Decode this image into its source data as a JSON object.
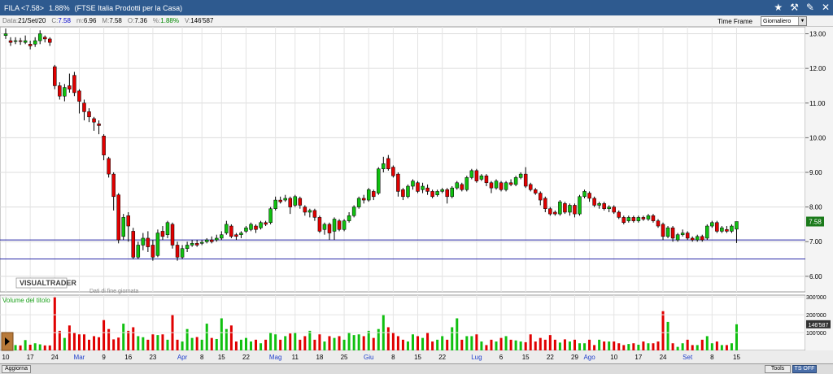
{
  "titlebar": {
    "symbol": "FILA <7.58>",
    "change": "1.88%",
    "market": "(FTSE Italia Prodotti per la Casa)",
    "icons": [
      "star-icon",
      "tool-icon",
      "pin-icon",
      "close-icon"
    ]
  },
  "infobar": {
    "date_label": "Data:",
    "date_value": "21/Set/20",
    "close_label": "C:",
    "close_value": "7.58",
    "min_label": "m:",
    "min_value": "6.96",
    "max_label": "M:",
    "max_value": "7.58",
    "open_label": "O:",
    "open_value": "7.36",
    "pct_label": "%:",
    "pct_value": "1.88%",
    "vol_label": "V:",
    "vol_value": "146'587",
    "timeframe_label": "Time Frame",
    "timeframe_value": "Giornaliero"
  },
  "footer": {
    "refresh_label": "Aggiorna",
    "tools_label": "Tools",
    "tsoff_label": "TS OFF"
  },
  "chart_data": {
    "type": "candlestick",
    "title": "",
    "price_axis_ticks": [
      "13.00",
      "12.00",
      "11.00",
      "10.00",
      "9.00",
      "8.00",
      "7.00",
      "6.00"
    ],
    "price_range": [
      5.55,
      13.2
    ],
    "last_price_label": "7.58",
    "watermark": "VISUALTRADER",
    "watermark_sub": "Dati di fine giornata",
    "volume_title": "Volume del titolo",
    "volume_ticks": [
      "300'000",
      "200'000",
      "100'000"
    ],
    "volume_range": [
      0,
      310000
    ],
    "last_volume_label": "146'587",
    "horizontal_lines": [
      7.05,
      6.5
    ],
    "date_labels": [
      {
        "i": 0,
        "text": "10",
        "month": false
      },
      {
        "i": 5,
        "text": "17",
        "month": false
      },
      {
        "i": 10,
        "text": "24",
        "month": false
      },
      {
        "i": 15,
        "text": "Mar",
        "month": true
      },
      {
        "i": 20,
        "text": "9",
        "month": false
      },
      {
        "i": 25,
        "text": "16",
        "month": false
      },
      {
        "i": 30,
        "text": "23",
        "month": false
      },
      {
        "i": 36,
        "text": "Apr",
        "month": true
      },
      {
        "i": 40,
        "text": "8",
        "month": false
      },
      {
        "i": 44,
        "text": "15",
        "month": false
      },
      {
        "i": 49,
        "text": "22",
        "month": false
      },
      {
        "i": 55,
        "text": "Mag",
        "month": true
      },
      {
        "i": 59,
        "text": "11",
        "month": false
      },
      {
        "i": 64,
        "text": "18",
        "month": false
      },
      {
        "i": 69,
        "text": "25",
        "month": false
      },
      {
        "i": 74,
        "text": "Giu",
        "month": true
      },
      {
        "i": 79,
        "text": "8",
        "month": false
      },
      {
        "i": 84,
        "text": "15",
        "month": false
      },
      {
        "i": 89,
        "text": "22",
        "month": false
      },
      {
        "i": 96,
        "text": "Lug",
        "month": true
      },
      {
        "i": 101,
        "text": "6",
        "month": false
      },
      {
        "i": 106,
        "text": "15",
        "month": false
      },
      {
        "i": 111,
        "text": "22",
        "month": false
      },
      {
        "i": 116,
        "text": "29",
        "month": false
      },
      {
        "i": 119,
        "text": "Ago",
        "month": true
      },
      {
        "i": 124,
        "text": "10",
        "month": false
      },
      {
        "i": 129,
        "text": "17",
        "month": false
      },
      {
        "i": 134,
        "text": "24",
        "month": false
      },
      {
        "i": 139,
        "text": "Set",
        "month": true
      },
      {
        "i": 144,
        "text": "8",
        "month": false
      },
      {
        "i": 149,
        "text": "15",
        "month": false
      }
    ],
    "candles": [
      [
        12.95,
        13.0,
        12.85,
        13.15
      ],
      [
        12.8,
        12.75,
        12.65,
        12.9
      ],
      [
        12.78,
        12.8,
        12.7,
        12.9
      ],
      [
        12.8,
        12.78,
        12.68,
        12.88
      ],
      [
        12.75,
        12.8,
        12.7,
        12.95
      ],
      [
        12.7,
        12.65,
        12.55,
        12.8
      ],
      [
        12.7,
        12.8,
        12.62,
        12.9
      ],
      [
        12.8,
        13.0,
        12.7,
        13.1
      ],
      [
        12.9,
        12.85,
        12.75,
        12.95
      ],
      [
        12.85,
        12.75,
        12.65,
        12.9
      ],
      [
        12.05,
        11.5,
        11.4,
        12.1
      ],
      [
        11.5,
        11.2,
        11.1,
        11.6
      ],
      [
        11.2,
        11.45,
        11.05,
        11.55
      ],
      [
        11.5,
        11.4,
        11.3,
        11.85
      ],
      [
        11.8,
        11.3,
        11.2,
        11.9
      ],
      [
        11.35,
        11.05,
        10.7,
        11.4
      ],
      [
        11.0,
        10.75,
        10.5,
        11.1
      ],
      [
        10.75,
        10.6,
        10.45,
        10.85
      ],
      [
        10.55,
        10.45,
        10.2,
        10.6
      ],
      [
        10.4,
        10.35,
        10.1,
        10.5
      ],
      [
        10.05,
        9.5,
        9.35,
        10.1
      ],
      [
        9.4,
        8.95,
        8.85,
        9.45
      ],
      [
        8.95,
        8.3,
        7.9,
        9.0
      ],
      [
        8.35,
        7.05,
        6.95,
        8.4
      ],
      [
        7.15,
        7.7,
        7.05,
        7.8
      ],
      [
        7.75,
        7.45,
        7.0,
        7.85
      ],
      [
        7.3,
        6.55,
        6.5,
        7.4
      ],
      [
        6.55,
        6.9,
        6.5,
        7.0
      ],
      [
        6.9,
        7.1,
        6.75,
        7.25
      ],
      [
        7.1,
        6.85,
        6.7,
        7.3
      ],
      [
        6.9,
        6.55,
        6.45,
        7.05
      ],
      [
        6.6,
        7.25,
        6.55,
        7.35
      ],
      [
        7.3,
        7.15,
        7.05,
        7.45
      ],
      [
        7.2,
        7.55,
        7.1,
        7.6
      ],
      [
        7.5,
        6.9,
        6.8,
        7.55
      ],
      [
        6.9,
        6.55,
        6.45,
        7.0
      ],
      [
        6.55,
        6.8,
        6.5,
        6.9
      ],
      [
        6.8,
        6.9,
        6.7,
        7.0
      ],
      [
        6.9,
        6.95,
        6.85,
        7.05
      ],
      [
        6.95,
        6.9,
        6.85,
        7.05
      ],
      [
        6.95,
        6.98,
        6.9,
        7.05
      ],
      [
        7.0,
        7.05,
        6.95,
        7.1
      ],
      [
        7.05,
        7.0,
        6.95,
        7.15
      ],
      [
        7.05,
        7.1,
        7.0,
        7.2
      ],
      [
        7.1,
        7.2,
        7.05,
        7.3
      ],
      [
        7.25,
        7.5,
        7.2,
        7.6
      ],
      [
        7.45,
        7.15,
        7.1,
        7.5
      ],
      [
        7.2,
        7.15,
        7.05,
        7.25
      ],
      [
        7.2,
        7.25,
        7.1,
        7.3
      ],
      [
        7.3,
        7.4,
        7.25,
        7.45
      ],
      [
        7.35,
        7.5,
        7.3,
        7.55
      ],
      [
        7.45,
        7.35,
        7.25,
        7.5
      ],
      [
        7.4,
        7.55,
        7.35,
        7.6
      ],
      [
        7.55,
        7.5,
        7.45,
        7.6
      ],
      [
        7.55,
        7.95,
        7.5,
        8.0
      ],
      [
        7.95,
        8.2,
        7.9,
        8.3
      ],
      [
        8.2,
        8.15,
        8.1,
        8.3
      ],
      [
        8.2,
        8.25,
        8.15,
        8.35
      ],
      [
        8.25,
        8.0,
        7.8,
        8.3
      ],
      [
        8.05,
        8.3,
        8.0,
        8.35
      ],
      [
        8.25,
        8.05,
        7.95,
        8.3
      ],
      [
        8.0,
        7.85,
        7.75,
        8.05
      ],
      [
        7.85,
        7.9,
        7.7,
        7.95
      ],
      [
        7.9,
        7.7,
        7.6,
        7.95
      ],
      [
        7.7,
        7.3,
        7.25,
        7.75
      ],
      [
        7.35,
        7.5,
        7.2,
        7.55
      ],
      [
        7.5,
        7.25,
        7.05,
        7.55
      ],
      [
        7.3,
        7.65,
        7.05,
        7.7
      ],
      [
        7.6,
        7.35,
        7.3,
        7.65
      ],
      [
        7.35,
        7.6,
        7.3,
        7.65
      ],
      [
        7.6,
        7.75,
        7.55,
        7.85
      ],
      [
        7.75,
        8.0,
        7.7,
        8.05
      ],
      [
        8.0,
        8.25,
        7.95,
        8.3
      ],
      [
        8.25,
        8.2,
        8.1,
        8.35
      ],
      [
        8.2,
        8.5,
        8.15,
        8.55
      ],
      [
        8.45,
        8.3,
        8.2,
        8.5
      ],
      [
        8.4,
        9.1,
        8.35,
        9.15
      ],
      [
        9.1,
        9.25,
        9.0,
        9.45
      ],
      [
        9.4,
        9.1,
        9.05,
        9.5
      ],
      [
        9.15,
        8.9,
        8.85,
        9.2
      ],
      [
        8.95,
        8.45,
        8.3,
        9.0
      ],
      [
        8.5,
        8.3,
        8.2,
        8.55
      ],
      [
        8.3,
        8.6,
        8.25,
        8.65
      ],
      [
        8.6,
        8.75,
        8.5,
        8.8
      ],
      [
        8.7,
        8.45,
        8.4,
        8.75
      ],
      [
        8.5,
        8.6,
        8.4,
        8.7
      ],
      [
        8.55,
        8.45,
        8.35,
        8.65
      ],
      [
        8.45,
        8.3,
        8.25,
        8.5
      ],
      [
        8.35,
        8.45,
        8.3,
        8.5
      ],
      [
        8.45,
        8.5,
        8.4,
        8.55
      ],
      [
        8.5,
        8.3,
        8.1,
        8.55
      ],
      [
        8.3,
        8.55,
        8.25,
        8.6
      ],
      [
        8.55,
        8.7,
        8.5,
        8.75
      ],
      [
        8.65,
        8.5,
        8.45,
        8.7
      ],
      [
        8.5,
        8.85,
        8.45,
        8.9
      ],
      [
        8.85,
        9.05,
        8.8,
        9.1
      ],
      [
        9.05,
        8.75,
        8.7,
        9.1
      ],
      [
        8.8,
        8.9,
        8.75,
        8.95
      ],
      [
        8.9,
        8.7,
        8.6,
        8.95
      ],
      [
        8.7,
        8.55,
        8.4,
        8.75
      ],
      [
        8.55,
        8.75,
        8.5,
        8.8
      ],
      [
        8.7,
        8.5,
        8.45,
        8.75
      ],
      [
        8.5,
        8.7,
        8.45,
        8.75
      ],
      [
        8.7,
        8.65,
        8.6,
        8.8
      ],
      [
        8.65,
        8.85,
        8.6,
        8.9
      ],
      [
        8.85,
        8.95,
        8.8,
        9.0
      ],
      [
        8.95,
        8.6,
        8.55,
        9.15
      ],
      [
        8.65,
        8.5,
        8.45,
        8.7
      ],
      [
        8.5,
        8.4,
        8.35,
        8.55
      ],
      [
        8.4,
        8.2,
        8.05,
        8.45
      ],
      [
        8.25,
        7.95,
        7.85,
        8.3
      ],
      [
        7.95,
        7.8,
        7.75,
        8.0
      ],
      [
        7.85,
        7.8,
        7.75,
        7.9
      ],
      [
        7.8,
        8.15,
        7.75,
        8.2
      ],
      [
        8.1,
        7.85,
        7.8,
        8.15
      ],
      [
        7.85,
        8.05,
        7.75,
        8.1
      ],
      [
        8.05,
        7.8,
        7.7,
        8.1
      ],
      [
        7.8,
        8.3,
        7.75,
        8.35
      ],
      [
        8.3,
        8.45,
        8.25,
        8.5
      ],
      [
        8.4,
        8.25,
        8.15,
        8.45
      ],
      [
        8.25,
        8.05,
        8.0,
        8.3
      ],
      [
        8.05,
        8.1,
        7.95,
        8.15
      ],
      [
        8.1,
        7.95,
        7.9,
        8.15
      ],
      [
        7.95,
        8.0,
        7.85,
        8.05
      ],
      [
        8.0,
        7.85,
        7.8,
        8.05
      ],
      [
        7.85,
        7.7,
        7.65,
        7.9
      ],
      [
        7.7,
        7.55,
        7.5,
        7.75
      ],
      [
        7.6,
        7.7,
        7.55,
        7.75
      ],
      [
        7.7,
        7.6,
        7.55,
        7.75
      ],
      [
        7.6,
        7.7,
        7.55,
        7.75
      ],
      [
        7.7,
        7.65,
        7.6,
        7.75
      ],
      [
        7.65,
        7.75,
        7.6,
        7.8
      ],
      [
        7.75,
        7.6,
        7.55,
        7.8
      ],
      [
        7.6,
        7.45,
        7.4,
        7.65
      ],
      [
        7.5,
        7.15,
        7.05,
        7.55
      ],
      [
        7.15,
        7.4,
        7.1,
        7.45
      ],
      [
        7.4,
        7.1,
        7.0,
        7.45
      ],
      [
        7.05,
        7.2,
        7.0,
        7.25
      ],
      [
        7.2,
        7.25,
        7.15,
        7.35
      ],
      [
        7.25,
        7.1,
        7.05,
        7.3
      ],
      [
        7.1,
        7.05,
        7.0,
        7.15
      ],
      [
        7.05,
        7.15,
        7.0,
        7.2
      ],
      [
        7.15,
        7.05,
        7.0,
        7.2
      ],
      [
        7.1,
        7.45,
        7.05,
        7.5
      ],
      [
        7.45,
        7.55,
        7.4,
        7.6
      ],
      [
        7.55,
        7.3,
        7.25,
        7.6
      ],
      [
        7.3,
        7.4,
        7.25,
        7.45
      ],
      [
        7.35,
        7.3,
        7.25,
        7.45
      ],
      [
        7.3,
        7.45,
        7.25,
        7.5
      ],
      [
        7.36,
        7.58,
        6.96,
        7.58
      ]
    ],
    "volumes": [
      38000,
      44000,
      30000,
      28000,
      58000,
      32000,
      40000,
      34000,
      28000,
      28000,
      300000,
      110000,
      70000,
      140000,
      100000,
      90000,
      90000,
      60000,
      80000,
      74000,
      170000,
      120000,
      62000,
      72000,
      150000,
      110000,
      130000,
      80000,
      74000,
      60000,
      90000,
      86000,
      90000,
      60000,
      200000,
      60000,
      50000,
      120000,
      70000,
      75000,
      60000,
      150000,
      70000,
      64000,
      180000,
      120000,
      140000,
      50000,
      60000,
      70000,
      50000,
      60000,
      40000,
      60000,
      100000,
      90000,
      60000,
      80000,
      95000,
      100000,
      60000,
      80000,
      110000,
      60000,
      90000,
      50000,
      80000,
      70000,
      80000,
      60000,
      100000,
      86000,
      90000,
      80000,
      110000,
      70000,
      120000,
      200000,
      130000,
      100000,
      80000,
      60000,
      50000,
      90000,
      80000,
      70000,
      100000,
      50000,
      60000,
      80000,
      60000,
      130000,
      180000,
      60000,
      80000,
      80000,
      90000,
      50000,
      30000,
      60000,
      50000,
      70000,
      80000,
      60000,
      56000,
      50000,
      46000,
      90000,
      50000,
      70000,
      60000,
      86000,
      60000,
      44000,
      62000,
      50000,
      60000,
      40000,
      40000,
      60000,
      30000,
      60000,
      50000,
      50000,
      50000,
      40000,
      30000,
      36000,
      40000,
      32000,
      50000,
      40000,
      40000,
      50000,
      220000,
      160000,
      40000,
      20000,
      40000,
      60000,
      30000,
      30000,
      60000,
      80000,
      40000,
      50000,
      30000,
      30000,
      40000,
      146587
    ]
  }
}
